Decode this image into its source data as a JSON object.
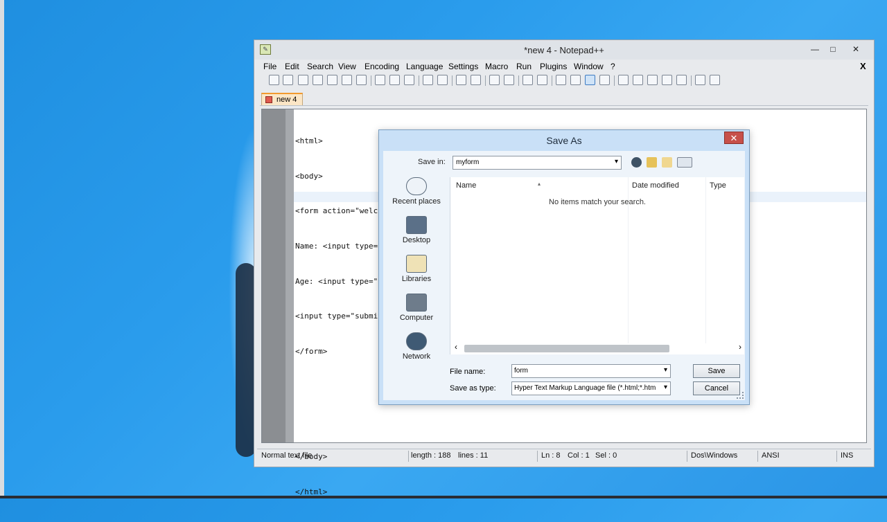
{
  "window": {
    "title": "*new 4 - Notepad++",
    "min_glyph": "—",
    "max_glyph": "□",
    "close_glyph": "✕"
  },
  "menu": [
    "File",
    "Edit",
    "Search",
    "View",
    "Encoding",
    "Language",
    "Settings",
    "Macro",
    "Run",
    "Plugins",
    "Window",
    "?"
  ],
  "menu_close": "X",
  "tabs": [
    {
      "label": "new 4"
    }
  ],
  "editor": {
    "lines": [
      "<html>",
      "<body>",
      "<form action=\"welcome.php\" method=\"post\">",
      "Name: <input type=\"text\" name=\"fname\">",
      "Age: <input type=\"text\" name=\"age\">",
      "<input type=\"submit\">",
      "</form>",
      "",
      "",
      "</body>",
      "</html>"
    ]
  },
  "status": {
    "file_type": "Normal text file",
    "length": "length : 188",
    "lines": "lines : 11",
    "ln": "Ln : 8",
    "col": "Col : 1",
    "sel": "Sel : 0",
    "eol": "Dos\\Windows",
    "encoding": "ANSI",
    "mode": "INS"
  },
  "dialog": {
    "title": "Save As",
    "close": "✕",
    "save_in_label": "Save in:",
    "save_in_value": "myform",
    "places": [
      "Recent places",
      "Desktop",
      "Libraries",
      "Computer",
      "Network"
    ],
    "columns": [
      "Name",
      "Date modified",
      "Type"
    ],
    "empty_message": "No items match your search.",
    "file_name_label": "File name:",
    "file_name_value": "form",
    "save_type_label": "Save as type:",
    "save_type_value": "Hyper Text Markup Language file (*.html;*.htm;*",
    "save_button": "Save",
    "cancel_button": "Cancel"
  },
  "colors": {
    "desktop": "#2a9cec",
    "tab_accent": "#f29a2e",
    "dialog_frame": "#c9e0f7",
    "dialog_close": "#c7504a"
  }
}
